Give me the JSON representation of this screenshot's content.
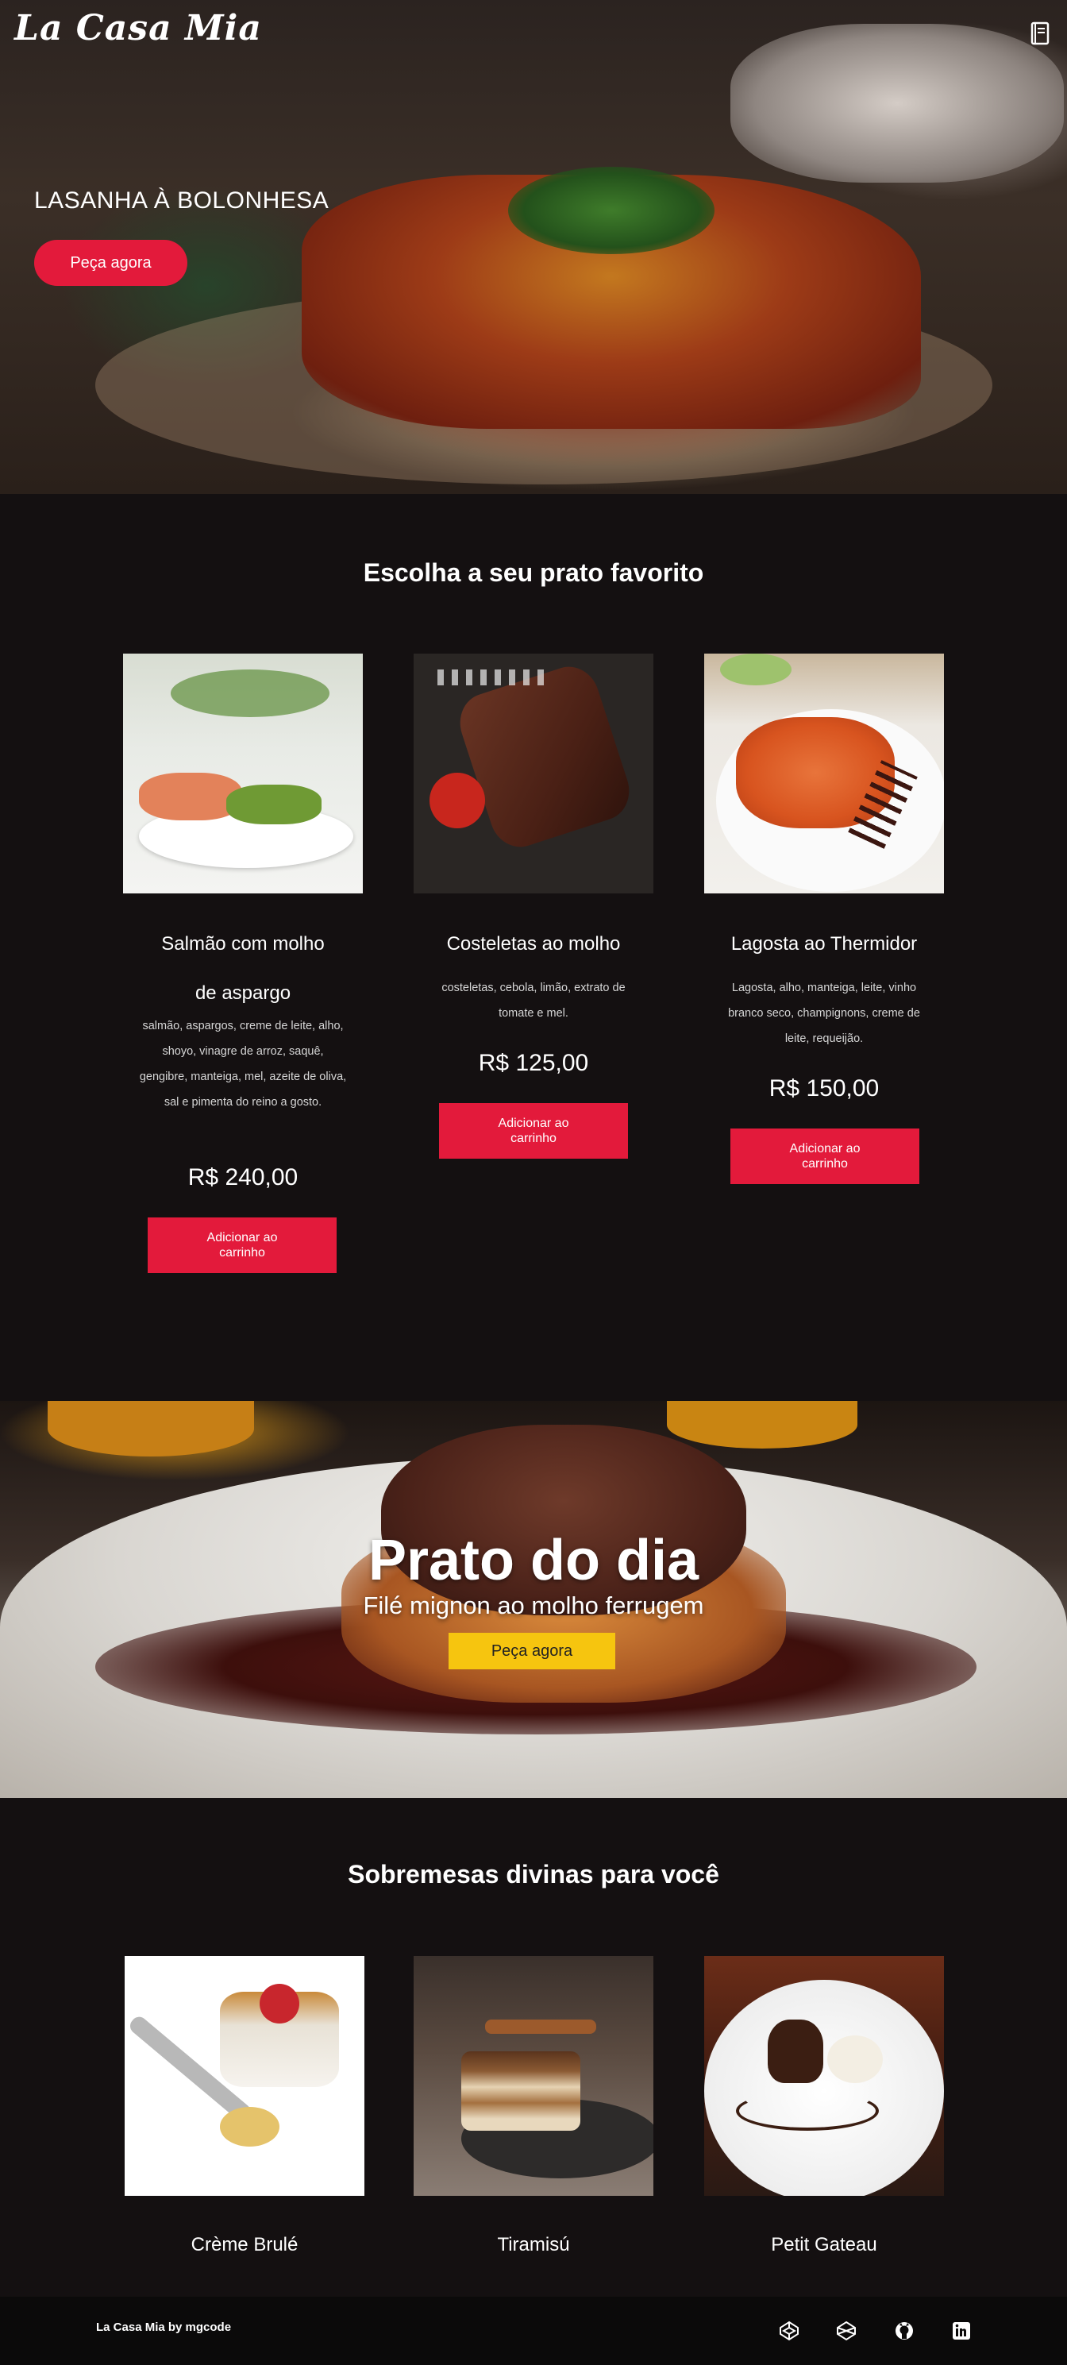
{
  "brand": {
    "name": "La Casa Mia"
  },
  "hero": {
    "title": "LASANHA À BOLONHESA",
    "cta": "Peça agora",
    "menu_icon": "book-icon"
  },
  "mains": {
    "title": "Escolha a seu prato favorito",
    "dishes": [
      {
        "name_line1": "Salmão com molho",
        "name_line2": "de aspargo",
        "description": "salmão, aspargos, creme de leite, alho, shoyo, vinagre de arroz, saquê, gengibre, manteiga, mel, azeite de oliva, sal e pimenta do reino a gosto.",
        "price": "R$ 240,00",
        "button": "Adicionar ao carrinho"
      },
      {
        "name_line1": "Costeletas ao molho",
        "name_line2": "",
        "description": "costeletas, cebola, limão, extrato de tomate e mel.",
        "price": "R$ 125,00",
        "button": "Adicionar ao carrinho"
      },
      {
        "name_line1": "Lagosta ao Thermidor",
        "name_line2": "",
        "description": "Lagosta, alho, manteiga, leite, vinho branco seco, champignons, creme de leite, requeijão.",
        "price": "R$ 150,00",
        "button": "Adicionar ao carrinho"
      }
    ]
  },
  "daily": {
    "title": "Prato do dia",
    "subtitle": "Filé mignon ao molho ferrugem",
    "cta": "Peça agora"
  },
  "desserts": {
    "title": "Sobremesas divinas para você",
    "items": [
      {
        "name": "Crème Brulé"
      },
      {
        "name": "Tiramisú"
      },
      {
        "name": "Petit Gateau"
      }
    ]
  },
  "footer": {
    "credit": "La Casa Mia by mgcode",
    "icons": [
      "codepen-icon",
      "codepen-alt-icon",
      "github-icon",
      "linkedin-icon"
    ]
  },
  "colors": {
    "accent": "#e31a3b",
    "daily_button": "#f6c50f",
    "background": "#141011"
  }
}
